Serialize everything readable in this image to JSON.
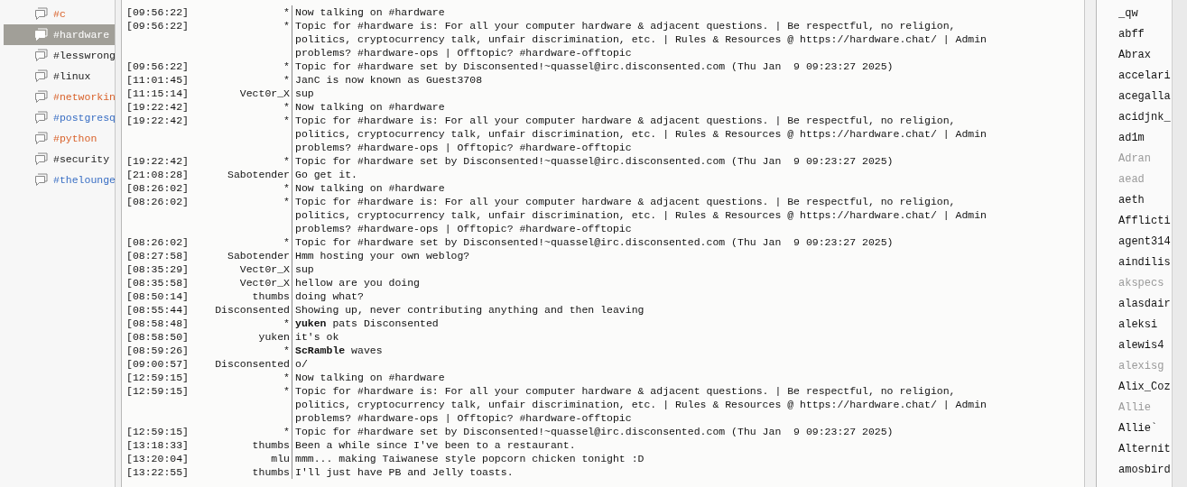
{
  "channels": [
    {
      "name": "#c",
      "kind": "message",
      "selected": false
    },
    {
      "name": "#hardware",
      "kind": "plain",
      "selected": true
    },
    {
      "name": "#lesswrong",
      "kind": "plain",
      "selected": false
    },
    {
      "name": "#linux",
      "kind": "plain",
      "selected": false
    },
    {
      "name": "#networkin",
      "kind": "message",
      "selected": false
    },
    {
      "name": "#postgresq",
      "kind": "activity",
      "selected": false
    },
    {
      "name": "#python",
      "kind": "message",
      "selected": false
    },
    {
      "name": "#security",
      "kind": "plain",
      "selected": false
    },
    {
      "name": "#thelounge",
      "kind": "activity",
      "selected": false
    }
  ],
  "messages": [
    {
      "time": "[09:56:22]",
      "nick": "*",
      "text": "Now talking on #hardware"
    },
    {
      "time": "[09:56:22]",
      "nick": "*",
      "text": "Topic for #hardware is: For all your computer hardware & adjacent questions. | Be respectful, no religion, politics, cryptocurrency talk, unfair discrimination, etc. | Rules & Resources @ https://hardware.chat/ | Admin problems? #hardware-ops | Offtopic? #hardware-offtopic"
    },
    {
      "time": "[09:56:22]",
      "nick": "*",
      "text": "Topic for #hardware set by Disconsented!~quassel@irc.disconsented.com (Thu Jan  9 09:23:27 2025)"
    },
    {
      "time": "[11:01:45]",
      "nick": "*",
      "text": "JanC is now known as Guest3708"
    },
    {
      "time": "[11:15:14]",
      "nick": "Vect0r_X",
      "text": "sup"
    },
    {
      "time": "[19:22:42]",
      "nick": "*",
      "text": "Now talking on #hardware"
    },
    {
      "time": "[19:22:42]",
      "nick": "*",
      "text": "Topic for #hardware is: For all your computer hardware & adjacent questions. | Be respectful, no religion, politics, cryptocurrency talk, unfair discrimination, etc. | Rules & Resources @ https://hardware.chat/ | Admin problems? #hardware-ops | Offtopic? #hardware-offtopic"
    },
    {
      "time": "[19:22:42]",
      "nick": "*",
      "text": "Topic for #hardware set by Disconsented!~quassel@irc.disconsented.com (Thu Jan  9 09:23:27 2025)"
    },
    {
      "time": "[21:08:28]",
      "nick": "Sabotender",
      "text": "Go get it."
    },
    {
      "time": "[08:26:02]",
      "nick": "*",
      "text": "Now talking on #hardware"
    },
    {
      "time": "[08:26:02]",
      "nick": "*",
      "text": "Topic for #hardware is: For all your computer hardware & adjacent questions. | Be respectful, no religion, politics, cryptocurrency talk, unfair discrimination, etc. | Rules & Resources @ https://hardware.chat/ | Admin problems? #hardware-ops | Offtopic? #hardware-offtopic"
    },
    {
      "time": "[08:26:02]",
      "nick": "*",
      "text": "Topic for #hardware set by Disconsented!~quassel@irc.disconsented.com (Thu Jan  9 09:23:27 2025)"
    },
    {
      "time": "[08:27:58]",
      "nick": "Sabotender",
      "text": "Hmm hosting your own weblog?"
    },
    {
      "time": "[08:35:29]",
      "nick": "Vect0r_X",
      "text": "sup"
    },
    {
      "time": "[08:35:58]",
      "nick": "Vect0r_X",
      "text": "hellow are you doing"
    },
    {
      "time": "[08:50:14]",
      "nick": "thumbs",
      "text": "doing what?"
    },
    {
      "time": "[08:55:44]",
      "nick": "Disconsented",
      "text": "Showing up, never contributing anything and then leaving"
    },
    {
      "time": "[08:58:48]",
      "nick": "*",
      "text": "**yuken** pats Disconsented"
    },
    {
      "time": "[08:58:50]",
      "nick": "yuken",
      "text": "it's ok"
    },
    {
      "time": "[08:59:26]",
      "nick": "*",
      "text": "**ScRamble** waves"
    },
    {
      "time": "[09:00:57]",
      "nick": "Disconsented",
      "text": "o/"
    },
    {
      "time": "[12:59:15]",
      "nick": "*",
      "text": "Now talking on #hardware"
    },
    {
      "time": "[12:59:15]",
      "nick": "*",
      "text": "Topic for #hardware is: For all your computer hardware & adjacent questions. | Be respectful, no religion, politics, cryptocurrency talk, unfair discrimination, etc. | Rules & Resources @ https://hardware.chat/ | Admin problems? #hardware-ops | Offtopic? #hardware-offtopic"
    },
    {
      "time": "[12:59:15]",
      "nick": "*",
      "text": "Topic for #hardware set by Disconsented!~quassel@irc.disconsented.com (Thu Jan  9 09:23:27 2025)"
    },
    {
      "time": "[13:18:33]",
      "nick": "thumbs",
      "text": "Been a while since I've been to a restaurant."
    },
    {
      "time": "[13:20:04]",
      "nick": "mlu",
      "text": "mmm... making Taiwanese style popcorn chicken tonight :D"
    },
    {
      "time": "[13:22:55]",
      "nick": "thumbs",
      "text": "I'll just have PB and Jelly toasts."
    }
  ],
  "users": [
    {
      "name": "_qw",
      "away": false
    },
    {
      "name": "abff",
      "away": false
    },
    {
      "name": "Abrax",
      "away": false
    },
    {
      "name": "accelari",
      "away": false
    },
    {
      "name": "acegalla",
      "away": false
    },
    {
      "name": "acidjnk_",
      "away": false
    },
    {
      "name": "ad1m",
      "away": false
    },
    {
      "name": "Adran",
      "away": true
    },
    {
      "name": "aead",
      "away": true
    },
    {
      "name": "aeth",
      "away": false
    },
    {
      "name": "Afflicti",
      "away": false
    },
    {
      "name": "agent314",
      "away": false
    },
    {
      "name": "aindilis",
      "away": false
    },
    {
      "name": "akspecs",
      "away": true
    },
    {
      "name": "alasdair",
      "away": false
    },
    {
      "name": "aleksi",
      "away": false
    },
    {
      "name": "alewis4",
      "away": false
    },
    {
      "name": "alexisg",
      "away": true
    },
    {
      "name": "Alix_Coz",
      "away": false
    },
    {
      "name": "Allie",
      "away": true
    },
    {
      "name": "Allie`",
      "away": false
    },
    {
      "name": "Alternit",
      "away": false
    },
    {
      "name": "amosbird",
      "away": false
    }
  ]
}
